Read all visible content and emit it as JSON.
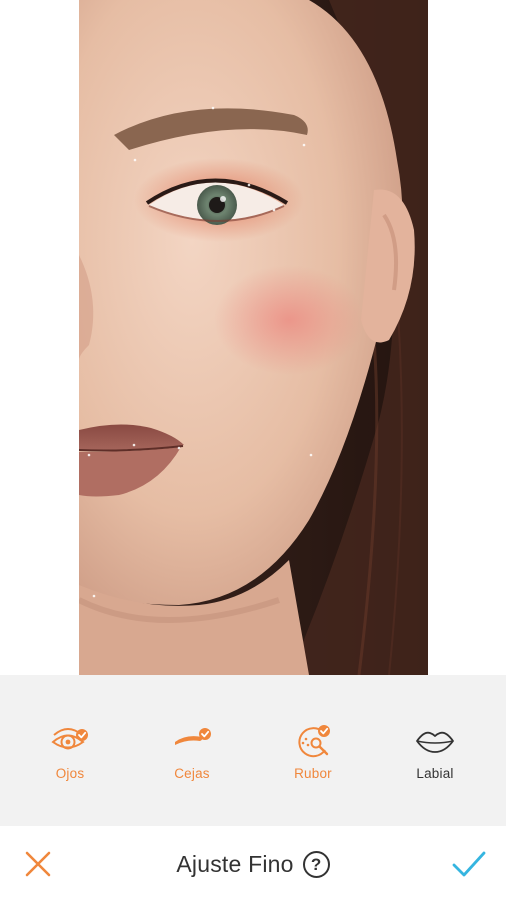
{
  "colors": {
    "accent": "#f0873c",
    "confirm": "#35b5e0",
    "toolbar_bg": "#f2f2f2",
    "text_dark": "#333333"
  },
  "tools": [
    {
      "label": "Ojos",
      "icon": "eye-check-icon",
      "active": true
    },
    {
      "label": "Cejas",
      "icon": "eyebrow-check-icon",
      "active": true
    },
    {
      "label": "Rubor",
      "icon": "blush-check-icon",
      "active": true
    },
    {
      "label": "Labial",
      "icon": "lips-icon",
      "active": false
    }
  ],
  "bottom_bar": {
    "title": "Ajuste Fino",
    "help_symbol": "?",
    "cancel_icon": "close-icon",
    "confirm_icon": "checkmark-icon"
  }
}
